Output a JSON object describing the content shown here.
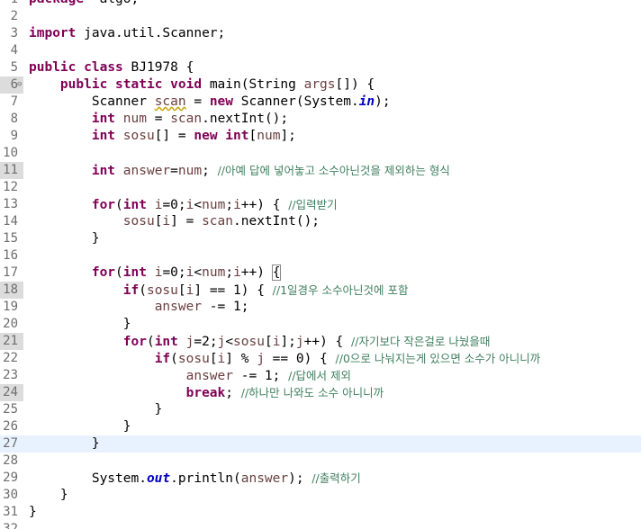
{
  "editor": {
    "language": "java",
    "current_line": 27,
    "changed_lines": [
      6,
      11,
      18,
      21,
      24
    ],
    "foldable_lines": [
      6
    ],
    "lines": [
      {
        "n": "1",
        "t": [
          [
            "kw",
            "package"
          ],
          [
            "",
            "  algo;"
          ]
        ]
      },
      {
        "n": "2",
        "t": []
      },
      {
        "n": "3",
        "t": [
          [
            "kw",
            "import"
          ],
          [
            "",
            " java.util.Scanner;"
          ]
        ]
      },
      {
        "n": "4",
        "t": []
      },
      {
        "n": "5",
        "t": [
          [
            "kw",
            "public"
          ],
          [
            "",
            " "
          ],
          [
            "kw",
            "class"
          ],
          [
            "",
            " BJ1978 {"
          ]
        ]
      },
      {
        "n": "6",
        "t": [
          [
            "",
            "    "
          ],
          [
            "kw",
            "public"
          ],
          [
            "",
            " "
          ],
          [
            "kw",
            "static"
          ],
          [
            "",
            " "
          ],
          [
            "kw",
            "void"
          ],
          [
            "",
            " main(String "
          ],
          [
            "var",
            "args"
          ],
          [
            "",
            "[]) {"
          ]
        ]
      },
      {
        "n": "7",
        "t": [
          [
            "",
            "        Scanner "
          ],
          [
            "var warn",
            "scan"
          ],
          [
            "",
            " = "
          ],
          [
            "kw",
            "new"
          ],
          [
            "",
            " Scanner(System."
          ],
          [
            "fld",
            "in"
          ],
          [
            "",
            ");"
          ]
        ]
      },
      {
        "n": "8",
        "t": [
          [
            "",
            "        "
          ],
          [
            "kw",
            "int"
          ],
          [
            "",
            " "
          ],
          [
            "var",
            "num"
          ],
          [
            "",
            " = "
          ],
          [
            "var",
            "scan"
          ],
          [
            "",
            ".nextInt();"
          ]
        ]
      },
      {
        "n": "9",
        "t": [
          [
            "",
            "        "
          ],
          [
            "kw",
            "int"
          ],
          [
            "",
            " "
          ],
          [
            "var",
            "sosu"
          ],
          [
            "",
            "[] = "
          ],
          [
            "kw",
            "new"
          ],
          [
            "",
            " "
          ],
          [
            "kw",
            "int"
          ],
          [
            "",
            "["
          ],
          [
            "var",
            "num"
          ],
          [
            "",
            "];"
          ]
        ]
      },
      {
        "n": "10",
        "t": []
      },
      {
        "n": "11",
        "t": [
          [
            "",
            "        "
          ],
          [
            "kw",
            "int"
          ],
          [
            "",
            " "
          ],
          [
            "var",
            "answer"
          ],
          [
            "",
            "="
          ],
          [
            "var",
            "num"
          ],
          [
            "",
            "; "
          ],
          [
            "cm",
            "//아예 답에 넣어놓고 소수아닌것을 제외하는 형식"
          ]
        ]
      },
      {
        "n": "12",
        "t": []
      },
      {
        "n": "13",
        "t": [
          [
            "",
            "        "
          ],
          [
            "kw",
            "for"
          ],
          [
            "",
            "("
          ],
          [
            "kw",
            "int"
          ],
          [
            "",
            " "
          ],
          [
            "var",
            "i"
          ],
          [
            "",
            "=0;"
          ],
          [
            "var",
            "i"
          ],
          [
            "",
            "<"
          ],
          [
            "var",
            "num"
          ],
          [
            "",
            ";"
          ],
          [
            "var",
            "i"
          ],
          [
            "",
            "++) { "
          ],
          [
            "cm",
            "//입력받기"
          ]
        ]
      },
      {
        "n": "14",
        "t": [
          [
            "",
            "            "
          ],
          [
            "var",
            "sosu"
          ],
          [
            "",
            "["
          ],
          [
            "var",
            "i"
          ],
          [
            "",
            "] = "
          ],
          [
            "var",
            "scan"
          ],
          [
            "",
            ".nextInt();"
          ]
        ]
      },
      {
        "n": "15",
        "t": [
          [
            "",
            "        }"
          ]
        ]
      },
      {
        "n": "16",
        "t": []
      },
      {
        "n": "17",
        "t": [
          [
            "",
            "        "
          ],
          [
            "kw",
            "for"
          ],
          [
            "",
            "("
          ],
          [
            "kw",
            "int"
          ],
          [
            "",
            " "
          ],
          [
            "var",
            "i"
          ],
          [
            "",
            "=0;"
          ],
          [
            "var",
            "i"
          ],
          [
            "",
            "<"
          ],
          [
            "var",
            "num"
          ],
          [
            "",
            ";"
          ],
          [
            "var",
            "i"
          ],
          [
            "",
            "++) "
          ],
          [
            "bracket",
            "{"
          ]
        ]
      },
      {
        "n": "18",
        "t": [
          [
            "",
            "            "
          ],
          [
            "kw",
            "if"
          ],
          [
            "",
            "("
          ],
          [
            "var",
            "sosu"
          ],
          [
            "",
            "["
          ],
          [
            "var",
            "i"
          ],
          [
            "",
            "] == 1) { "
          ],
          [
            "cm",
            "//1일경우 소수아닌것에 포함"
          ]
        ]
      },
      {
        "n": "19",
        "t": [
          [
            "",
            "                "
          ],
          [
            "var",
            "answer"
          ],
          [
            "",
            " -= 1;"
          ]
        ]
      },
      {
        "n": "20",
        "t": [
          [
            "",
            "            }"
          ]
        ]
      },
      {
        "n": "21",
        "t": [
          [
            "",
            "            "
          ],
          [
            "kw",
            "for"
          ],
          [
            "",
            "("
          ],
          [
            "kw",
            "int"
          ],
          [
            "",
            " "
          ],
          [
            "var",
            "j"
          ],
          [
            "",
            "=2;"
          ],
          [
            "var",
            "j"
          ],
          [
            "",
            "<"
          ],
          [
            "var",
            "sosu"
          ],
          [
            "",
            "["
          ],
          [
            "var",
            "i"
          ],
          [
            "",
            "];"
          ],
          [
            "var",
            "j"
          ],
          [
            "",
            "++) { "
          ],
          [
            "cm",
            "//자기보다 작은걸로 나눴을때"
          ]
        ]
      },
      {
        "n": "22",
        "t": [
          [
            "",
            "                "
          ],
          [
            "kw",
            "if"
          ],
          [
            "",
            "("
          ],
          [
            "var",
            "sosu"
          ],
          [
            "",
            "["
          ],
          [
            "var",
            "i"
          ],
          [
            "",
            "] % "
          ],
          [
            "var",
            "j"
          ],
          [
            "",
            " == 0) { "
          ],
          [
            "cm",
            "//0으로 나눠지는게 있으면 소수가 아니니까"
          ]
        ]
      },
      {
        "n": "23",
        "t": [
          [
            "",
            "                    "
          ],
          [
            "var",
            "answer"
          ],
          [
            "",
            " -= 1; "
          ],
          [
            "cm",
            "//답에서 제외"
          ]
        ]
      },
      {
        "n": "24",
        "t": [
          [
            "",
            "                    "
          ],
          [
            "kw",
            "break"
          ],
          [
            "",
            "; "
          ],
          [
            "cm",
            "//하나만 나와도 소수 아니니까"
          ]
        ]
      },
      {
        "n": "25",
        "t": [
          [
            "",
            "                }"
          ]
        ]
      },
      {
        "n": "26",
        "t": [
          [
            "",
            "            }"
          ]
        ]
      },
      {
        "n": "27",
        "t": [
          [
            "",
            "        }"
          ]
        ]
      },
      {
        "n": "28",
        "t": []
      },
      {
        "n": "29",
        "t": [
          [
            "",
            "        System."
          ],
          [
            "fld",
            "out"
          ],
          [
            "",
            ".println("
          ],
          [
            "var",
            "answer"
          ],
          [
            "",
            "); "
          ],
          [
            "cm",
            "//출력하기"
          ]
        ]
      },
      {
        "n": "30",
        "t": [
          [
            "",
            "    }"
          ]
        ]
      },
      {
        "n": "31",
        "t": [
          [
            "",
            "}"
          ]
        ]
      },
      {
        "n": "32",
        "t": []
      }
    ]
  },
  "icons": {
    "fold": "collapse-minus-icon"
  },
  "colors": {
    "keyword": "#7f0055",
    "comment": "#3f7f5f",
    "field": "#0000c0",
    "variable": "#6a3e3e",
    "line_number": "#6e6e6e",
    "current_line": "#e8f2fe",
    "changed_marker": "#dcdcdc"
  }
}
